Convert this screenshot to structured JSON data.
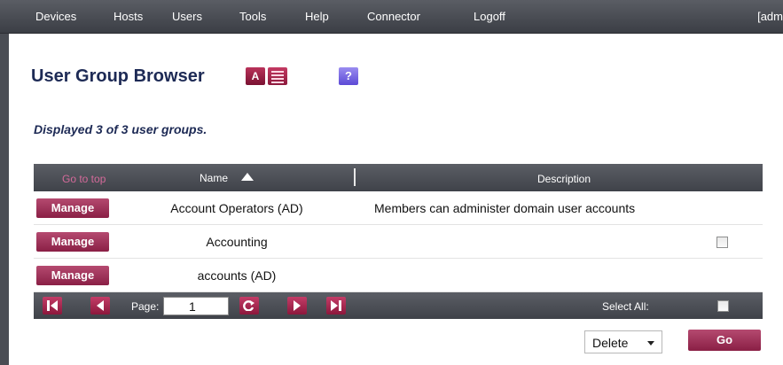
{
  "nav": {
    "items": [
      "Devices",
      "Hosts",
      "Users",
      "Tools",
      "Help",
      "Connector",
      "Logoff"
    ],
    "user": "[adm"
  },
  "page": {
    "title": "User Group Browser",
    "az_label": "A",
    "help_label": "?",
    "summary": "Displayed 3 of 3 user groups."
  },
  "table": {
    "go_top": "Go to top",
    "col_name": "Name",
    "col_description": "Description",
    "manage_label": "Manage",
    "rows": [
      {
        "name": "Account Operators (AD)",
        "description": "Members can administer domain user accounts",
        "checkbox": false
      },
      {
        "name": "Accounting",
        "description": "",
        "checkbox": true
      },
      {
        "name": "accounts (AD)",
        "description": "",
        "checkbox": false
      }
    ]
  },
  "pager": {
    "page_label": "Page:",
    "page_value": "1",
    "select_all_label": "Select All:"
  },
  "actions": {
    "selected": "Delete",
    "go_label": "Go"
  },
  "colors": {
    "accent": "#8a1f45",
    "header_bg": "#3f4249",
    "title": "#1d2a55"
  }
}
